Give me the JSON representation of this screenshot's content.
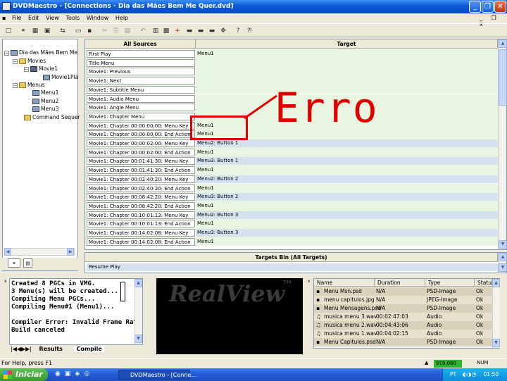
{
  "window": {
    "title": "DVDMaestro - [Connections - Dia das Mães Bem Me Quer.dvd]",
    "minimize": "_",
    "restore": "❐",
    "close": "✕"
  },
  "menubar": [
    "File",
    "Edit",
    "View",
    "Tools",
    "Window",
    "Help"
  ],
  "tree": {
    "close_glyph": "x",
    "items": [
      "Dia das Mães Bem Me",
      "Movies",
      "Movie1",
      "Movie1Pla",
      "Menus",
      "Menu1",
      "Menu2",
      "Menu3",
      "Command Sequer"
    ]
  },
  "connections": {
    "headers": {
      "sources": "All Sources",
      "target": "Target"
    },
    "rows": [
      {
        "source": "First Play",
        "target": "Menu1"
      },
      {
        "source": "Title Menu",
        "target": ""
      },
      {
        "source": "Movie1: Previous",
        "target": ""
      },
      {
        "source": "Movie1: Next",
        "target": ""
      },
      {
        "source": "Movie1: Subtitle Menu",
        "target": ""
      },
      {
        "source": "Movie1: Audio Menu",
        "target": ""
      },
      {
        "source": "Movie1: Angle Menu",
        "target": ""
      },
      {
        "source": "Movie1: Chapter Menu",
        "target": ""
      },
      {
        "source": "Movie1: Chapter 00:00:00;00: Menu Key",
        "target": "Menu1"
      },
      {
        "source": "Movie1: Chapter 00:00:00;00: End Action",
        "target": "Menu1"
      },
      {
        "source": "Movie1: Chapter 00:00:02:00: Menu Key",
        "target": "Menu2: Button 1"
      },
      {
        "source": "Movie1: Chapter 00:00:02:00: End Action",
        "target": "Menu1"
      },
      {
        "source": "Movie1: Chapter 00:01:41:30: Menu Key",
        "target": "Menu3: Button 1"
      },
      {
        "source": "Movie1: Chapter 00:01:41:30: End Action",
        "target": "Menu1"
      },
      {
        "source": "Movie1: Chapter 00:02:40:20: Menu Key",
        "target": "Menu2: Button 2"
      },
      {
        "source": "Movie1: Chapter 00:02:40:20: End Action",
        "target": "Menu1"
      },
      {
        "source": "Movie1: Chapter 00:08:42:20: Menu Key",
        "target": "Menu3: Button 2"
      },
      {
        "source": "Movie1: Chapter 00:08:42:20: End Action",
        "target": "Menu1"
      },
      {
        "source": "Movie1: Chapter 00:10:01:13: Menu Key",
        "target": "Menu2: Button 3"
      },
      {
        "source": "Movie1: Chapter 00:10:01:13: End Action",
        "target": "Menu1"
      },
      {
        "source": "Movie1: Chapter 00:14:02:08: Menu Key",
        "target": "Menu3: Button 3"
      },
      {
        "source": "Movie1: Chapter 00:14:02:08: End Action",
        "target": "Menu1"
      }
    ],
    "annotation": "Erro"
  },
  "targets_bin": {
    "header": "Targets Bin (All Targets)",
    "items": [
      "Resume Play"
    ]
  },
  "output": {
    "lines": [
      "Created 8 PGCs in VMG.",
      "3 Menu(s) will be created...",
      "Compiling Menu PGCs...",
      "Compiling Menu#1 (Menu1)...",
      "",
      "Compiler Error: Invalid Frame Rate",
      "Build canceled"
    ],
    "tabs": [
      "Results",
      "Compile"
    ]
  },
  "preview": {
    "logo": "RealView",
    "tm": "TM"
  },
  "files": {
    "headers": [
      "Name",
      "Duration",
      "Type",
      "Status"
    ],
    "rows": [
      {
        "name": "Menu Msn.psd",
        "duration": "N/A",
        "type": "PSD-Image",
        "status": "Ok"
      },
      {
        "name": "menu capitulos.jpg",
        "duration": "N/A",
        "type": "JPEG-Image",
        "status": "Ok"
      },
      {
        "name": "Menu Mensagens.psd",
        "duration": "N/A",
        "type": "PSD-Image",
        "status": "Ok"
      },
      {
        "name": "musica menu 3.wav",
        "duration": "00:02:47:03",
        "type": "Audio",
        "status": "Ok"
      },
      {
        "name": "musica menu 2.wav",
        "duration": "00:04:43:06",
        "type": "Audio",
        "status": "Ok"
      },
      {
        "name": "musica menu 1.wav",
        "duration": "00:04:02:15",
        "type": "Audio",
        "status": "Ok"
      },
      {
        "name": "Menu Capitulos.psd",
        "duration": "N/A",
        "type": "PSD-Image",
        "status": "Ok"
      }
    ]
  },
  "statusbar": {
    "help": "For Help, press F1",
    "memory": "919,080 M",
    "num": "NUM"
  },
  "taskbar": {
    "start": "Iniciar",
    "item": "DVDMaestro - [Conne...",
    "lang": "PT",
    "clock": "01:50"
  },
  "colors": {
    "row_green": "#e8f5e0",
    "row_blue": "#d4e2f0",
    "annotation_red": "#e00000",
    "memory_green": "#2fb52f"
  }
}
